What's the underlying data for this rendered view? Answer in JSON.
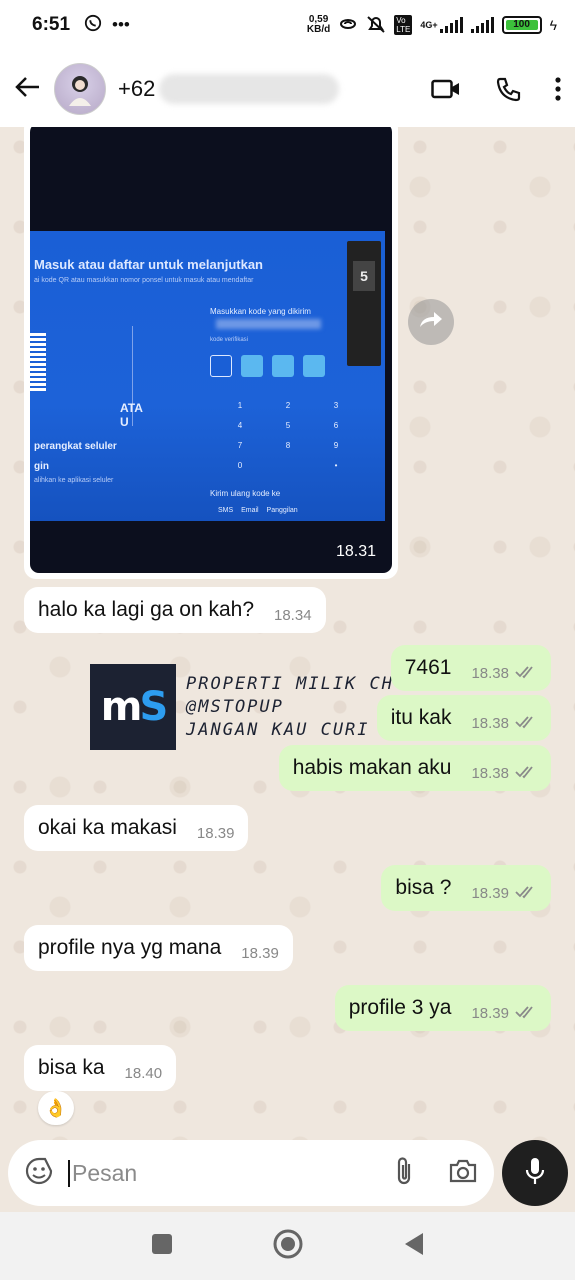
{
  "status_bar": {
    "time": "6:51",
    "speed_top": "0,59",
    "speed_bottom": "KB/d",
    "network": "4G+",
    "battery": "100"
  },
  "header": {
    "contact_prefix": "+62"
  },
  "image_message": {
    "time": "18.31",
    "screen": {
      "title": "Masuk atau daftar untuk melanjutkan",
      "subtitle": "ai kode QR atau masukkan nomor ponsel untuk masuk atau mendaftar",
      "ata": "ATA U",
      "perangkat": "perangkat seluler",
      "gin": "gin",
      "small": "alihkan ke aplikasi seluler",
      "kode_title": "Masukkan kode yang dikirim",
      "kode_verifikasi": "kode verifikasi",
      "keys": [
        "1",
        "2",
        "3",
        "4",
        "5",
        "6",
        "7",
        "8",
        "9",
        "0",
        "",
        "•"
      ],
      "kirim": "Kirim ulang kode ke",
      "options": "SMS  Email  Panggilan",
      "badge": "5"
    }
  },
  "messages": [
    {
      "dir": "in",
      "text": "halo ka lagi ga on kah?",
      "time": "18.34"
    },
    {
      "dir": "out",
      "text": "7461",
      "time": "18.38"
    },
    {
      "dir": "out",
      "text": "itu kak",
      "time": "18.38"
    },
    {
      "dir": "out",
      "text": "habis makan aku",
      "time": "18.38"
    },
    {
      "dir": "in",
      "text": "okai ka makasi",
      "time": "18.39"
    },
    {
      "dir": "out",
      "text": "bisa ?",
      "time": "18.39"
    },
    {
      "dir": "in",
      "text": "profile nya yg mana",
      "time": "18.39"
    },
    {
      "dir": "out",
      "text": "profile 3 ya",
      "time": "18.39"
    },
    {
      "dir": "in",
      "text": "bisa ka",
      "time": "18.40"
    }
  ],
  "reaction": "👌",
  "watermark": {
    "logo_m": "m",
    "logo_s": "S",
    "line1": "PROPERTI MILIK CH",
    "line2": "@MSTOPUP",
    "line3": "JANGAN KAU CURI"
  },
  "input": {
    "placeholder": "Pesan"
  },
  "colors": {
    "outgoing_bubble": "#dcf8c6",
    "incoming_bubble": "#ffffff",
    "chat_bg": "#efe7de",
    "tick": "#8a8a8a"
  }
}
